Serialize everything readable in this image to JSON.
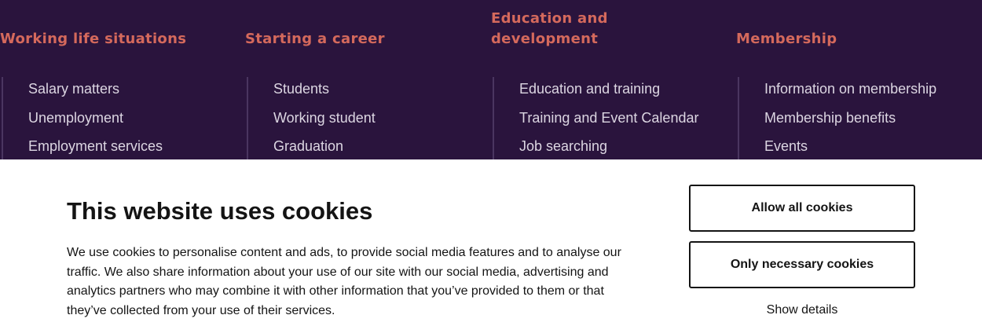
{
  "nav": {
    "columns": [
      {
        "heading": "Working life situations",
        "items": [
          "Salary matters",
          "Unemployment",
          "Employment services"
        ]
      },
      {
        "heading": "Starting a career",
        "items": [
          "Students",
          "Working student",
          "Graduation"
        ]
      },
      {
        "heading": "Education and development",
        "items": [
          "Education and training",
          "Training and Event Calendar",
          "Job searching"
        ]
      },
      {
        "heading": "Membership",
        "items": [
          "Information on membership",
          "Membership benefits",
          "Events"
        ]
      }
    ]
  },
  "cookie_banner": {
    "title": "This website uses cookies",
    "body": "We use cookies to personalise content and ads, to provide social media features and to analyse our traffic. We also share information about your use of our site with our social media, advertising and analytics partners who may combine it with other information that you’ve provided to them or that they’ve collected from your use of their services.",
    "allow_all_label": "Allow all cookies",
    "necessary_only_label": "Only necessary cookies",
    "show_details_label": "Show details"
  },
  "colors": {
    "nav_background": "#2a143d",
    "heading_accent": "#d4695c",
    "nav_link": "#dcd6e2",
    "banner_background": "#ffffff",
    "banner_text": "#141414"
  }
}
